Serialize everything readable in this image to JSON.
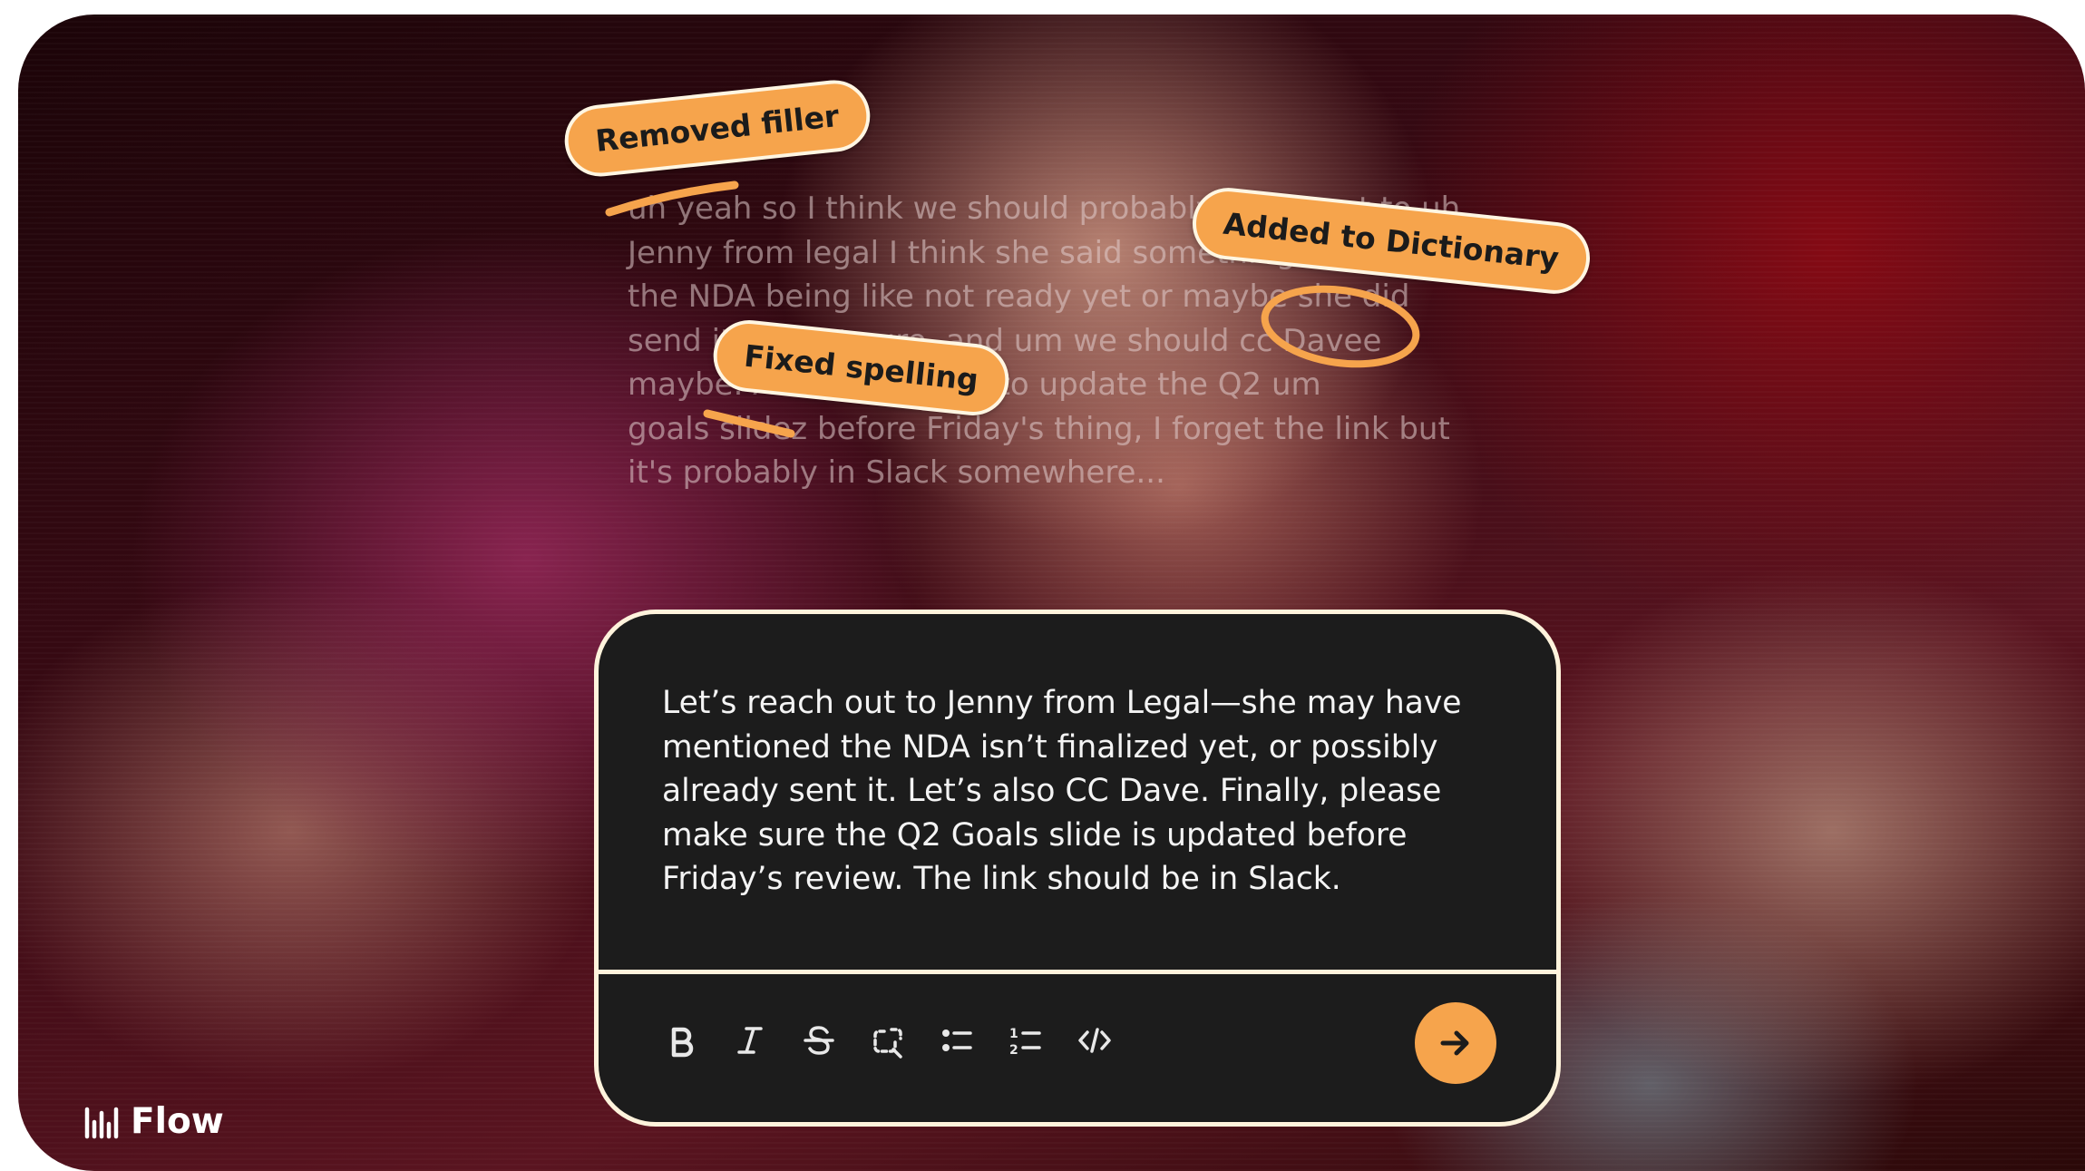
{
  "raw_transcript": {
    "lines": [
      "uh yeah so I think we should probably reach out to uh",
      "Jenny from legal I think she said something about",
      "the NDA being like not ready yet or maybe she did",
      "send it I'm not sure, and um we should cc Davee",
      "maybe. Also make sure to update the Q2 um",
      "goals slidez before Friday's thing, I forget the link but",
      "it's probably in Slack somewhere..."
    ]
  },
  "annotations": {
    "removed_filler": "Removed filler",
    "added_to_dictionary": "Added to Dictionary",
    "fixed_spelling": "Fixed spelling"
  },
  "editor": {
    "lines": [
      "Let’s reach out to Jenny from Legal—she may have",
      "mentioned the NDA isn’t finalized yet, or possibly",
      "already sent it. Let’s also CC Dave. Finally, please",
      "make sure the Q2 Goals slide is updated before",
      "Friday’s review. The link should be in Slack."
    ],
    "toolbar": [
      "bold-icon",
      "italic-icon",
      "strikethrough-icon",
      "unlink-icon",
      "bulleted-list-icon",
      "numbered-list-icon",
      "code-icon"
    ],
    "send_icon": "arrow-right-icon"
  },
  "brand": {
    "name": "Flow",
    "icon": "waveform-icon"
  },
  "colors": {
    "accent": "#f6a44c",
    "editor_bg": "#1c1c1c",
    "border": "#fff3dc"
  }
}
